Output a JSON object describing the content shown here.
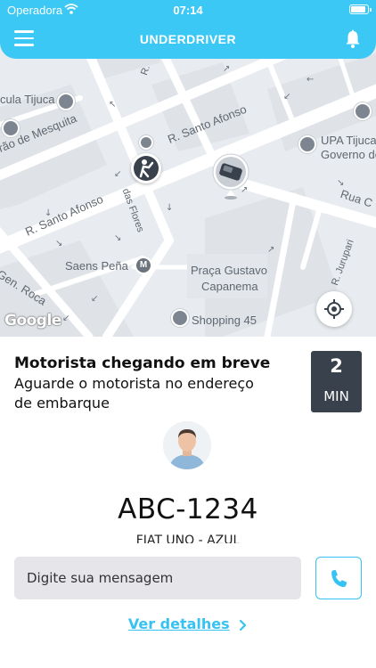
{
  "status_bar": {
    "carrier": "Operadora",
    "time": "07:14"
  },
  "nav": {
    "title": "UNDERDRIVER",
    "menu_icon": "hamburger-menu-icon",
    "bell_icon": "bell-icon"
  },
  "map": {
    "labels": {
      "cula_tijuca": "cula Tijuca",
      "arao_de_mesquita": "rão de Mesquita",
      "r_santo_afonso_top": "R. Santo Afonso",
      "r_santo_afonso_left": "R. Santo Afonso",
      "das_flores": "das Flores",
      "saens_pena": "Saens Peña",
      "gen_roca": "Gen. Roca",
      "praca_gustavo": "Praça Gustavo",
      "capanema": "Capanema",
      "shopping_45": "Shopping 45",
      "upa_tijuca": "UPA Tijuca",
      "governo_de": "Governo de",
      "rua_c": "Rua C",
      "r_jurupari": "R. Jurupari",
      "r_top": "R."
    },
    "attribution": "Google",
    "metro_letter": "M",
    "locate_icon": "locate-target-icon",
    "car_icon": "car-marker-icon",
    "passenger_icon": "passenger-waving-icon"
  },
  "panel": {
    "heading": "Motorista chegando em breve",
    "subtext": "Aguarde o motorista no endereço de embarque",
    "eta_value": "2",
    "eta_unit": "MIN",
    "plate": "ABC-1234",
    "car_model": "FIAT UNO - AZUL",
    "message_placeholder": "Digite sua mensagem",
    "details_label": "Ver detalhes",
    "phone_icon": "phone-icon"
  },
  "colors": {
    "brand": "#3cc8f4",
    "eta_bg": "#39414d",
    "link": "#36c2f2"
  }
}
